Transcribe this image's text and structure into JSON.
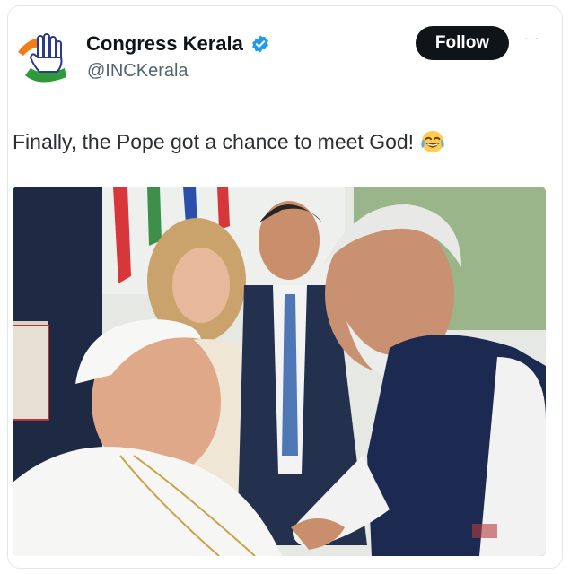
{
  "tweet": {
    "display_name": "Congress Kerala",
    "handle": "@INCKerala",
    "follow_label": "Follow",
    "more_label": "···",
    "text": "Finally, the Pope got a chance to meet God!",
    "emoji_icon": "face-with-tears-of-joy-icon",
    "verified_icon": "verified-badge-icon",
    "avatar_icon": "congress-hand-logo-icon"
  },
  "colors": {
    "follow_bg": "#0f1419",
    "verified": "#1d9bf0",
    "logo_saffron": "#f07d1a",
    "logo_green": "#2e9b3b"
  }
}
